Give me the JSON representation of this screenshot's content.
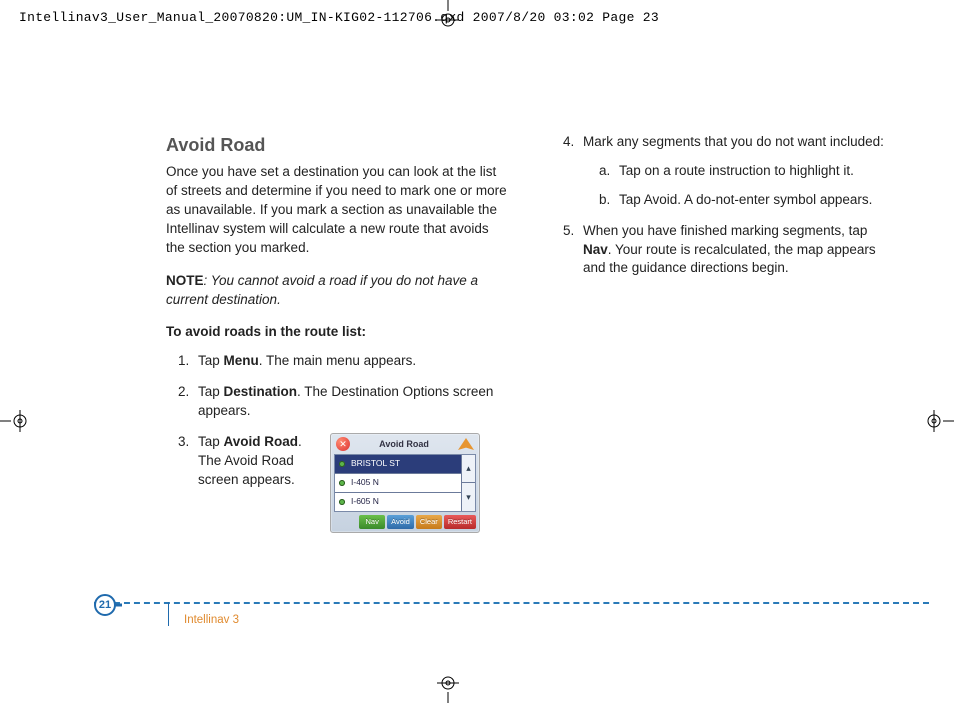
{
  "print_header": {
    "filename_line": "Intellinav3_User_Manual_20070820:UM_IN-KIG02-112706.qxd  2007/8/20      03:02  Page 23"
  },
  "section": {
    "title": "Avoid Road",
    "intro": "Once you have set a destination you can look at the list of streets and determine if you need to mark one or more as unavailable. If you mark a section as unavailable the Intellinav system will calculate a new route that avoids the section you marked.",
    "note_label": "NOTE",
    "note_text": ": You cannot avoid a road if you do not have a current destination.",
    "subhead": "To avoid roads in the route list:",
    "steps": {
      "s1_pre": "Tap ",
      "s1_bold": "Menu",
      "s1_post": ". The main menu appears.",
      "s2_pre": "Tap ",
      "s2_bold": "Destination",
      "s2_post": ". The Destination Options screen appears.",
      "s3_pre": "Tap ",
      "s3_bold": "Avoid Road",
      "s3_post": ". The Avoid Road screen appears.",
      "s4": "Mark any segments that you do not want included:",
      "s4a": "Tap on a route instruction to highlight it.",
      "s4b": "Tap Avoid. A do-not-enter symbol appears.",
      "s5_pre": "When you have finished marking segments, tap ",
      "s5_bold": "Nav",
      "s5_post": ". Your route is recalculated, the map appears and the guidance directions begin."
    }
  },
  "device": {
    "title": "Avoid Road",
    "rows": [
      "BRISTOL ST",
      "I-405 N",
      "I-605 N"
    ],
    "buttons": {
      "nav": "Nav",
      "avoid": "Avoid",
      "clear": "Clear",
      "restart": "Restart"
    }
  },
  "footer": {
    "page_number": "21",
    "product": "Intellinav 3"
  }
}
